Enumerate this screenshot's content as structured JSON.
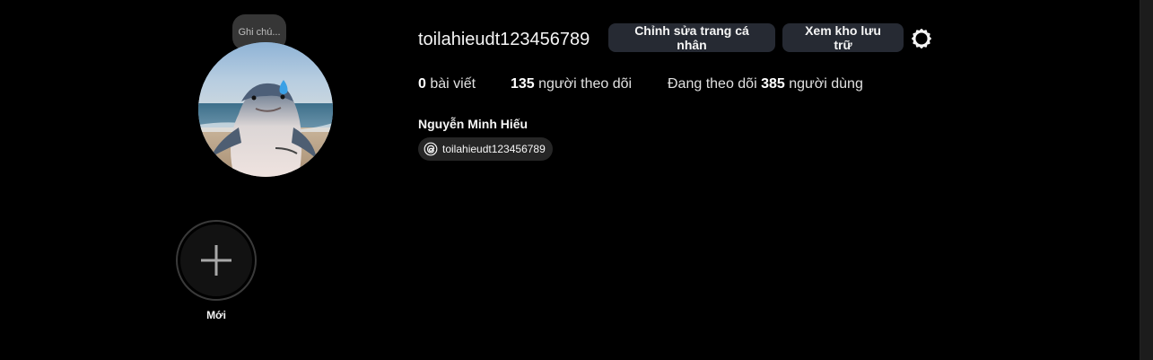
{
  "note": {
    "placeholder_text": "Ghi chú..."
  },
  "profile": {
    "username": "toilahieudt123456789",
    "full_name": "Nguyễn Minh Hiếu",
    "threads_handle": "toilahieudt123456789"
  },
  "actions": {
    "edit_profile_label": "Chỉnh sửa trang cá nhân",
    "view_archive_label": "Xem kho lưu trữ",
    "settings_icon": "gear-icon"
  },
  "stats": {
    "posts_count": "0",
    "posts_label": "bài viết",
    "followers_count": "135",
    "followers_label": "người theo dõi",
    "following_prefix": "Đang theo dõi",
    "following_count": "385",
    "following_label": "người dùng"
  },
  "highlights": {
    "new_label": "Mới",
    "new_icon": "plus-icon"
  },
  "colors": {
    "background": "#000000",
    "button_bg": "#262a33",
    "badge_bg": "#262626",
    "text": "#f5f5f5"
  }
}
